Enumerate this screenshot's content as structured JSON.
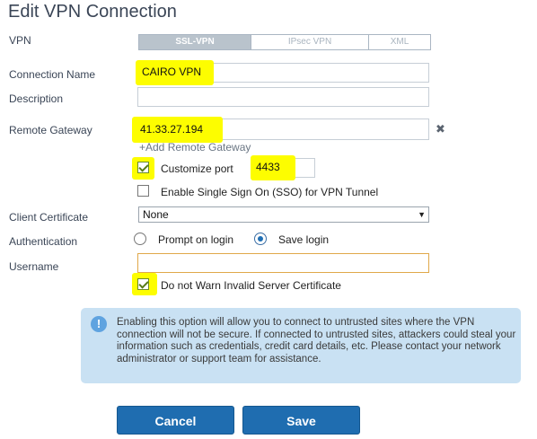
{
  "title": "Edit VPN Connection",
  "vpn": {
    "label": "VPN",
    "tabs": [
      "SSL-VPN",
      "IPsec VPN",
      "XML"
    ],
    "active_tab": "SSL-VPN"
  },
  "connection_name": {
    "label": "Connection Name",
    "value": "CAIRO VPN"
  },
  "description": {
    "label": "Description",
    "value": ""
  },
  "remote_gateway": {
    "label": "Remote Gateway",
    "value": "41.33.27.194",
    "remove_icon": "close-icon",
    "add_link": "+Add Remote Gateway"
  },
  "customize_port": {
    "label": "Customize port",
    "checked": true,
    "value": "4433"
  },
  "sso": {
    "label": "Enable Single Sign On (SSO) for VPN Tunnel",
    "checked": false
  },
  "client_certificate": {
    "label": "Client Certificate",
    "value": "None"
  },
  "authentication": {
    "label": "Authentication",
    "options": [
      "Prompt on login",
      "Save login"
    ],
    "selected": "Save login"
  },
  "username": {
    "label": "Username",
    "value": ""
  },
  "warn_cert": {
    "label": "Do not Warn Invalid Server Certificate",
    "checked": true
  },
  "info_message": "Enabling this option will allow you to connect to untrusted sites where the VPN connection will not be secure. If connected to untrusted sites, attackers could steal your information such as credentials, credit card details, etc. Please contact your network administrator or support team for assistance.",
  "buttons": {
    "cancel": "Cancel",
    "save": "Save"
  },
  "colors": {
    "highlight": "#fdfd00",
    "button": "#1f6db0",
    "info_bg": "#c9e1f3"
  }
}
